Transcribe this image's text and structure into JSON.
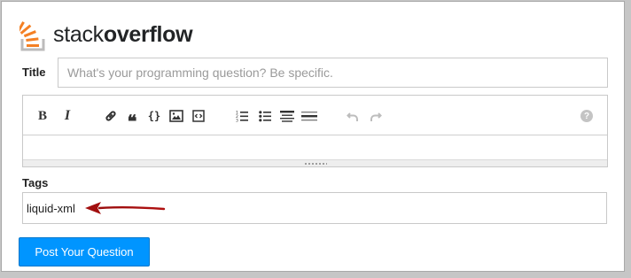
{
  "logo": {
    "text_regular": "stack",
    "text_bold": "overflow",
    "icon": "stack-overflow-logo-icon",
    "brand_color": "#f48024"
  },
  "title_field": {
    "label": "Title",
    "placeholder": "What's your programming question? Be specific.",
    "value": ""
  },
  "editor": {
    "toolbar": [
      {
        "name": "bold-button",
        "icon": "bold-icon",
        "glyph": "B"
      },
      {
        "name": "italic-button",
        "icon": "italic-icon",
        "glyph": "I"
      },
      {
        "name": "link-button",
        "icon": "link-icon"
      },
      {
        "name": "blockquote-button",
        "icon": "quote-icon",
        "glyph": "❝"
      },
      {
        "name": "code-button",
        "icon": "code-braces-icon",
        "glyph": "{}"
      },
      {
        "name": "image-button",
        "icon": "image-icon"
      },
      {
        "name": "snippet-button",
        "icon": "code-snippet-icon"
      },
      {
        "name": "numbered-list-button",
        "icon": "numbered-list-icon"
      },
      {
        "name": "bulleted-list-button",
        "icon": "bulleted-list-icon"
      },
      {
        "name": "heading-button",
        "icon": "heading-icon"
      },
      {
        "name": "horizontal-rule-button",
        "icon": "horizontal-rule-icon"
      },
      {
        "name": "undo-button",
        "icon": "undo-icon",
        "disabled": true
      },
      {
        "name": "redo-button",
        "icon": "redo-icon",
        "disabled": true
      },
      {
        "name": "help-button",
        "icon": "help-icon",
        "glyph": "?"
      }
    ],
    "body": ""
  },
  "tags_field": {
    "label": "Tags",
    "value": "liquid-xml"
  },
  "annotation": {
    "arrow_color": "#b01010"
  },
  "submit": {
    "label": "Post Your Question"
  }
}
